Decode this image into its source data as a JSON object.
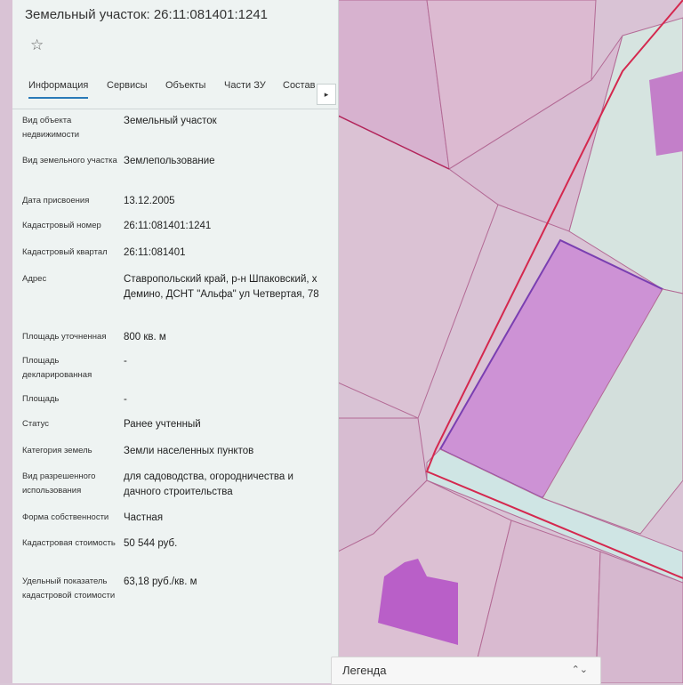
{
  "panel": {
    "title": "Земельный участок: 26:11:081401:1241",
    "tabs": [
      {
        "label": "Информация",
        "active": true
      },
      {
        "label": "Сервисы"
      },
      {
        "label": "Объекты"
      },
      {
        "label": "Части ЗУ"
      },
      {
        "label": "Состав"
      }
    ],
    "tab_scroll_icon": "caret-right-icon",
    "favorite_icon": "star-icon",
    "fields": [
      {
        "label": "Вид объекта недвижимости",
        "value": "Земельный участок"
      },
      {
        "label": "Вид земельного участка",
        "value": "Землепользование"
      },
      {
        "label": "Дата присвоения",
        "value": "13.12.2005"
      },
      {
        "label": "Кадастровый номер",
        "value": "26:11:081401:1241"
      },
      {
        "label": "Кадастровый квартал",
        "value": "26:11:081401"
      },
      {
        "label": "Адрес",
        "value": "Ставропольский край, р-н Шпаковский, х Демино, ДСНТ \"Альфа\" ул Четвертая, 78"
      },
      {
        "label": "Площадь уточненная",
        "value": "800 кв. м"
      },
      {
        "label": "Площадь декларированная",
        "value": "-"
      },
      {
        "label": "Площадь",
        "value": "-"
      },
      {
        "label": "Статус",
        "value": "Ранее учтенный"
      },
      {
        "label": "Категория земель",
        "value": "Земли населенных пунктов"
      },
      {
        "label": "Вид разрешенного использования",
        "value": "для садоводства, огородничества и дачного строительства"
      },
      {
        "label": "Форма собственности",
        "value": "Частная"
      },
      {
        "label": "Кадастровая стоимость",
        "value": "50 544 руб."
      },
      {
        "label": "Удельный показатель кадастровой стоимости",
        "value": "63,18 руб./кв. м"
      }
    ]
  },
  "legend": {
    "label": "Легенда",
    "icon": "chevron-updown-icon"
  },
  "colors": {
    "parcel_fill": "#d8b5d4",
    "selected_parcel": "#c77fd0",
    "boundary": "#d4284e",
    "road": "#cfe5e4"
  }
}
